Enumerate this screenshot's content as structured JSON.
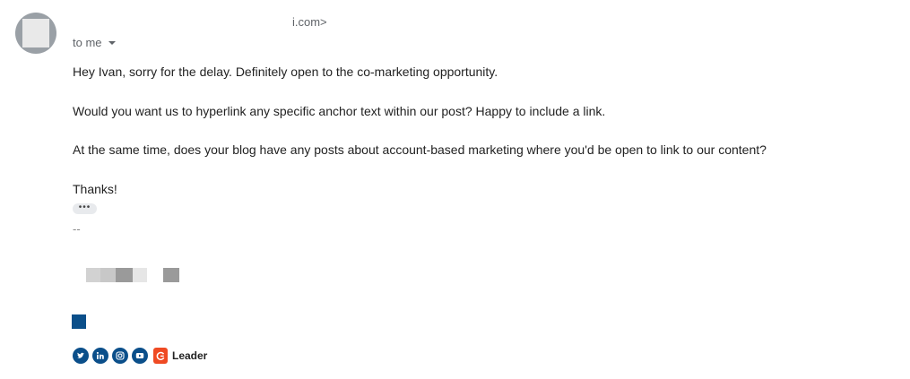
{
  "sender": {
    "email_fragment": "i.com>"
  },
  "recipient": {
    "label": "to me"
  },
  "body": {
    "greeting": "Hey Ivan, sorry for the delay. Definitely open to the co-marketing opportunity.",
    "question": "Would you want us to hyperlink any specific anchor text within our post? Happy to include a link.",
    "request": "At the same time, does your blog have any posts about account-based marketing where you'd be open to link to our content?",
    "closing": "Thanks!",
    "show_trimmed": "•••",
    "signature_separator": "--"
  },
  "signature": {
    "social_icons": [
      "twitter-icon",
      "linkedin-icon",
      "instagram-icon",
      "youtube-icon"
    ],
    "badge_label": "Leader",
    "brand_color": "#0b4f8a",
    "badge_color": "#ef4a23"
  }
}
